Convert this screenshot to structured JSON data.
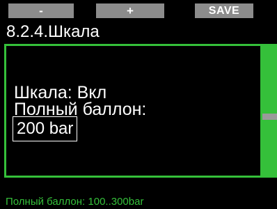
{
  "softkeys": {
    "left_label": "-",
    "middle_label": "+",
    "right_label": "SAVE"
  },
  "header": {
    "title": "8.2.4.Шкала"
  },
  "content": {
    "scale_line": "Шкала: Вкл",
    "full_tank_label": "Полный баллон:",
    "full_tank_value": "200 bar"
  },
  "footer": {
    "hint": "Полный баллон: 100..300bar"
  },
  "colors": {
    "accent": "#35c03a",
    "softkey_bg": "#8c8c8c",
    "background": "#000000",
    "text": "#ffffff"
  }
}
